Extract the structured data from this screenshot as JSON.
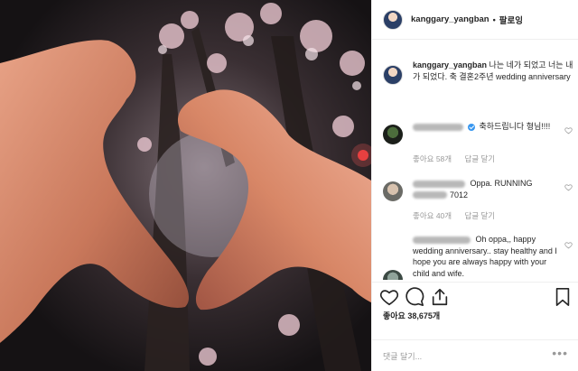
{
  "header": {
    "username": "kanggary_yangban",
    "separator": "•",
    "follow_label": "팔로잉"
  },
  "caption": {
    "username": "kanggary_yangban",
    "text": "나는 네가 되었고 너는 내가 되었다. 축 결혼2주년 wedding anniversary"
  },
  "comments": [
    {
      "text": "축하드립니다 형님!!!!",
      "likes": "좋아요 58개",
      "reply": "답글 달기",
      "verified": true
    },
    {
      "text": "Oppa. RUNNING",
      "text2": "7012",
      "likes": "좋아요 40개",
      "reply": "답글 달기",
      "verified": false
    },
    {
      "text": "Oh oppa,, happy wedding anniversary.. stay healthy and I hope you are always happy with your child and wife.",
      "verified": false
    }
  ],
  "likes_count": "좋아요 38,675개",
  "add_comment_placeholder": "댓글 달기...",
  "more_label": "•••",
  "colors": {
    "verified": "#3897f0",
    "muted": "#999999",
    "text": "#262626",
    "skin": "#d98a6a"
  }
}
